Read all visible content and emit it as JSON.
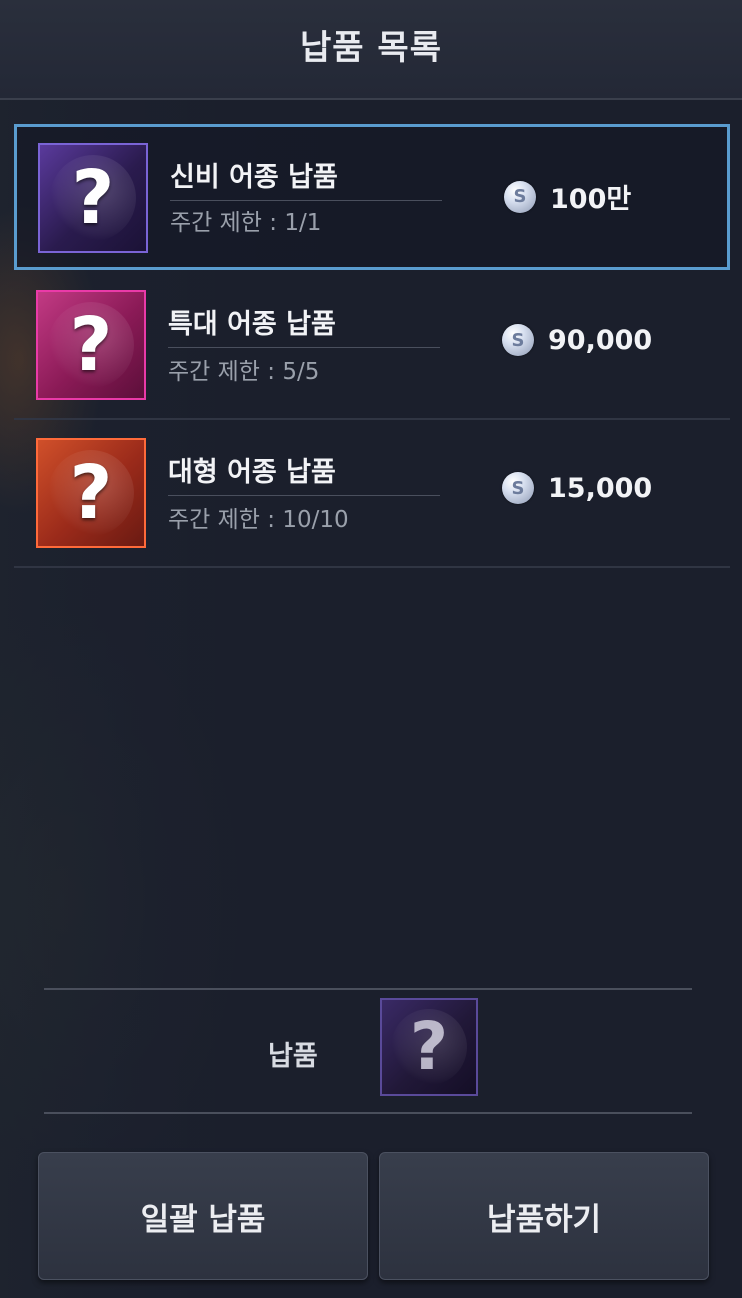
{
  "header": {
    "title": "납품 목록"
  },
  "items": [
    {
      "name": "신비 어종 납품",
      "limit": "주간 제한 : 1/1",
      "price": "100만",
      "icon": "mystery-fish-icon",
      "rarity_color": "#7a64d6",
      "selected": true
    },
    {
      "name": "특대 어종 납품",
      "limit": "주간 제한 : 5/5",
      "price": "90,000",
      "icon": "mystery-fish-icon",
      "rarity_color": "#ea3aa8",
      "selected": false
    },
    {
      "name": "대형 어종 납품",
      "limit": "주간 제한 : 10/10",
      "price": "15,000",
      "icon": "mystery-fish-icon",
      "rarity_color": "#ff6a3a",
      "selected": false
    }
  ],
  "coin": {
    "symbol": "S",
    "icon": "silver-coin-icon"
  },
  "question_mark": "?",
  "deliver": {
    "label": "납품",
    "slot_icon": "mystery-fish-icon"
  },
  "buttons": {
    "bulk": "일괄 납품",
    "deliver": "납품하기"
  },
  "colors": {
    "selection_border": "#5a9ccf",
    "background": "#1b1f2c"
  }
}
